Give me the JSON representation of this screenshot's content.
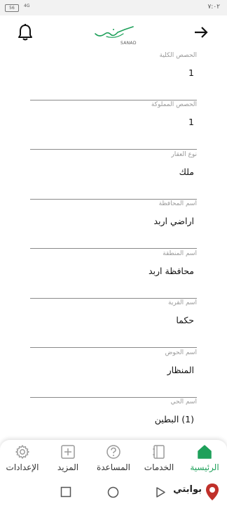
{
  "status_bar": {
    "time": "٧:٠٢",
    "battery": "56",
    "signal": "4G"
  },
  "header": {
    "logo_ar": "سند",
    "logo_en": "SANAD"
  },
  "fields": [
    {
      "label": "الحصص الكلية",
      "value": "1"
    },
    {
      "label": "الحصص المملوكة",
      "value": "1"
    },
    {
      "label": "نوع العقار",
      "value": "ملك"
    },
    {
      "label": "اسم المحافظة",
      "value": "اراضي اربد"
    },
    {
      "label": "اسم المنطقة",
      "value": "محافظة اربد"
    },
    {
      "label": "اسم القرية",
      "value": "حكما"
    },
    {
      "label": "اسم الحوض",
      "value": "المنظار"
    },
    {
      "label": "اسم الحي",
      "value": "(1) البطين"
    }
  ],
  "bottom_nav": {
    "items": [
      {
        "label": "الإعدادات",
        "icon": "gear-icon"
      },
      {
        "label": "المزيد",
        "icon": "plus-square-icon"
      },
      {
        "label": "المساعدة",
        "icon": "help-icon"
      },
      {
        "label": "الخدمات",
        "icon": "services-icon"
      },
      {
        "label": "الرئيسية",
        "icon": "home-icon"
      }
    ],
    "active_color": "#1ea05a",
    "inactive_color": "#9a9a9a"
  },
  "watermark": {
    "text": "بوابتي"
  }
}
